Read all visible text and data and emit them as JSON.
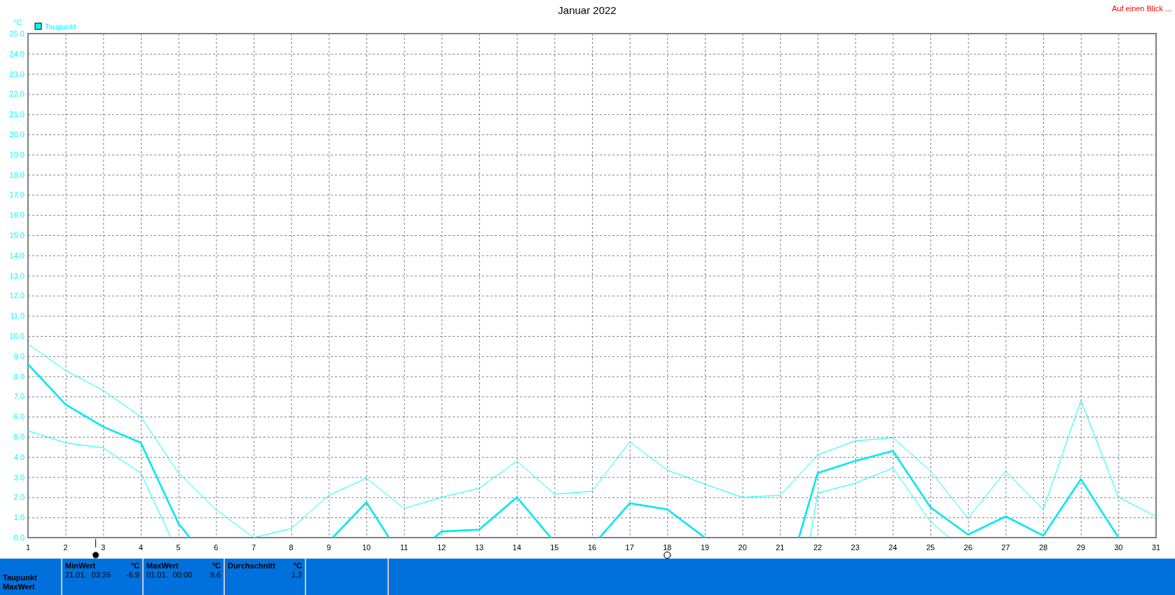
{
  "header": {
    "title": "Januar 2022",
    "link": "Auf einen Blick ..."
  },
  "chart": {
    "unit": "°C",
    "legend": [
      {
        "label": "Taupunkt",
        "color": "#00ffff"
      }
    ],
    "chart_data": {
      "type": "line",
      "x": [
        1,
        2,
        3,
        4,
        4.8,
        5,
        5.3,
        6,
        7,
        8,
        9,
        9.1,
        10,
        10.6,
        11,
        11.8,
        12,
        13,
        14,
        14.9,
        15,
        16,
        16.2,
        17,
        18,
        19,
        20,
        21,
        21.5,
        21.8,
        22,
        23,
        24,
        25,
        25.5,
        26,
        27,
        28,
        29,
        30,
        31
      ],
      "xticks": [
        1,
        2,
        3,
        4,
        5,
        6,
        7,
        8,
        9,
        10,
        11,
        12,
        13,
        14,
        15,
        16,
        17,
        18,
        19,
        20,
        21,
        22,
        23,
        24,
        25,
        26,
        27,
        28,
        29,
        30,
        31
      ],
      "ylim": [
        0,
        25
      ],
      "yticks": [
        {
          "value": 0,
          "label": "0.0"
        },
        {
          "value": 1,
          "label": "1.0"
        },
        {
          "value": 2,
          "label": "2.0"
        },
        {
          "value": 3,
          "label": "3.0"
        },
        {
          "value": 4,
          "label": "4.0"
        },
        {
          "value": 5,
          "label": "5.0"
        },
        {
          "value": 6,
          "label": "6.0"
        },
        {
          "value": 7,
          "label": "7.0"
        },
        {
          "value": 8,
          "label": "8.0"
        },
        {
          "value": 9,
          "label": "9.0"
        },
        {
          "value": 10,
          "label": "10.0"
        },
        {
          "value": 11,
          "label": "11.0"
        },
        {
          "value": 12,
          "label": "12.0"
        },
        {
          "value": 13,
          "label": "13.0"
        },
        {
          "value": 14,
          "label": "14.0"
        },
        {
          "value": 15,
          "label": "15.0"
        },
        {
          "value": 16,
          "label": "16.0"
        },
        {
          "value": 17,
          "label": "17.0"
        },
        {
          "value": 18,
          "label": "18.0"
        },
        {
          "value": 19,
          "label": "19.0"
        },
        {
          "value": 20,
          "label": "20.0"
        },
        {
          "value": 21,
          "label": "21.0"
        },
        {
          "value": 22,
          "label": "22.0"
        },
        {
          "value": 23,
          "label": "23.0"
        },
        {
          "value": 24,
          "label": "24.0"
        },
        {
          "value": 25,
          "label": "25.0"
        }
      ],
      "series": [
        {
          "color": "#00ffff",
          "values": [
            9.6,
            8.3,
            7.3,
            6.0,
            3.76,
            3.2,
            2.66,
            1.4,
            0.0,
            0.45,
            2.1,
            2.185,
            2.95,
            2.05,
            1.45,
            1.89,
            2.0,
            2.45,
            3.8,
            2.315,
            2.15,
            2.3,
            2.79,
            4.75,
            3.35,
            2.65,
            2.0,
            2.1,
            3.1,
            3.7,
            4.1,
            4.8,
            4.95,
            3.3,
            2.125,
            0.95,
            3.3,
            1.4,
            6.8,
            2.0,
            1.05
          ]
        },
        {
          "color": "#00e8f0",
          "values": [
            8.6,
            6.6,
            5.5,
            4.7,
            1.5,
            0.7,
            0,
            null,
            null,
            null,
            null,
            0,
            1.75,
            0,
            null,
            0,
            0.3,
            0.4,
            2.0,
            0,
            null,
            null,
            0,
            1.7,
            1.4,
            0,
            null,
            null,
            0,
            1.92,
            3.2,
            3.8,
            4.3,
            1.5,
            0.825,
            0.15,
            1.05,
            0.1,
            2.9,
            0,
            null
          ]
        },
        {
          "color": "#00ffff",
          "values": [
            5.3,
            4.7,
            4.45,
            3.2,
            0,
            null,
            null,
            null,
            null,
            null,
            null,
            null,
            null,
            null,
            null,
            null,
            null,
            null,
            null,
            null,
            null,
            null,
            null,
            null,
            null,
            null,
            null,
            null,
            null,
            0,
            2.2,
            2.7,
            3.45,
            0.8,
            0,
            null,
            null,
            null,
            null,
            null,
            null
          ]
        }
      ],
      "xlim": [
        1,
        31
      ],
      "grid": true
    },
    "moon_phases": [
      {
        "kind": "new"
      },
      {
        "kind": "full"
      }
    ]
  },
  "stats_panel": {
    "row_labels": [
      "Taupunkt",
      "MaxWert"
    ],
    "columns": [
      {
        "heading": "MinWert",
        "unit": "°C",
        "date": "21.01.",
        "time": "03:26",
        "value": "-6.9"
      },
      {
        "heading": "MaxWert",
        "unit": "°C",
        "date": "01.01.",
        "time": "00:00",
        "value": "9.6"
      },
      {
        "heading": "Durchschnitt",
        "unit": "°C",
        "value": "1.2"
      }
    ]
  }
}
